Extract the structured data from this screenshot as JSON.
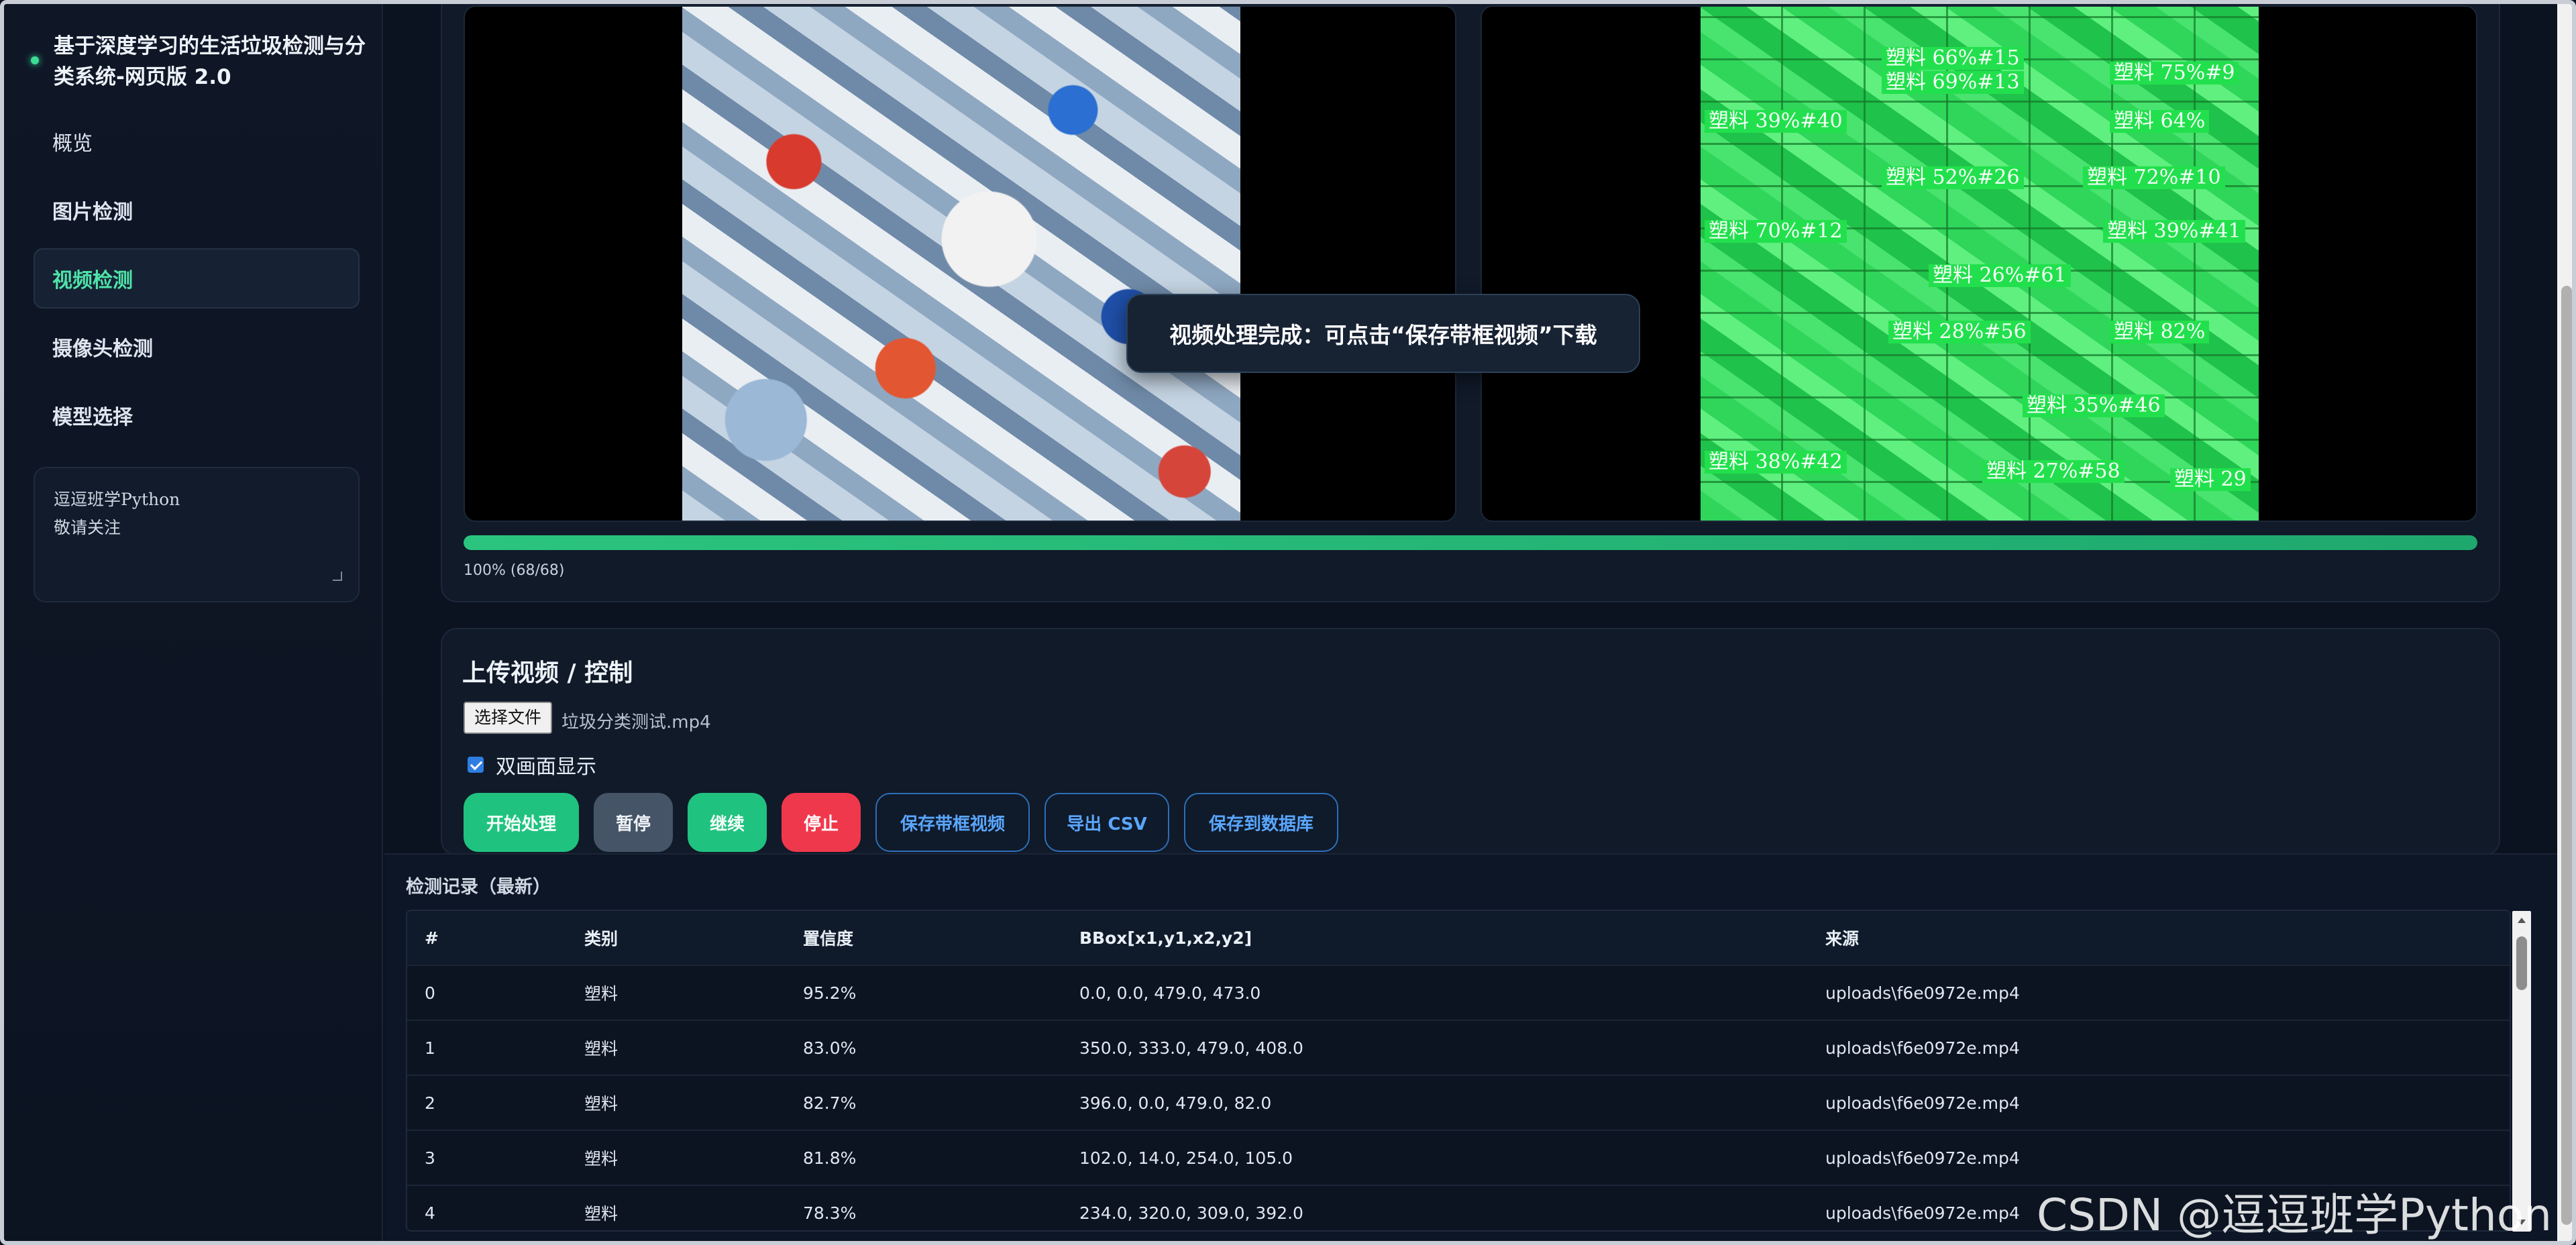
{
  "sidebar": {
    "title": "基于深度学习的生活垃圾检测与分类系统-网页版 2.0",
    "items": [
      {
        "label": "概览"
      },
      {
        "label": "图片检测"
      },
      {
        "label": "视频检测"
      },
      {
        "label": "摄像头检测"
      },
      {
        "label": "模型选择"
      }
    ],
    "note": "逗逗班学Python\n敬请关注"
  },
  "preview": {
    "tags": [
      "塑料 66%#15",
      "塑料 69%#13",
      "塑料 75%#9",
      "塑料 39%#40",
      "塑料 64%",
      "塑料 52%#26",
      "塑料 72%#10",
      "塑料 70%#12",
      "塑料 39%#41",
      "塑料 26%#61",
      "塑料 28%#56",
      "塑料 82%",
      "塑料 35%#46",
      "塑料 38%#42",
      "塑料 27%#58",
      "塑料 29"
    ],
    "toast": "视频处理完成：可点击“保存带框视频”下载",
    "progress": 1.0,
    "progress_text": "100% (68/68)"
  },
  "control": {
    "title": "上传视频 / 控制",
    "file_button": "选择文件",
    "file_name": "垃圾分类测试.mp4",
    "dual_view_label": "双画面显示",
    "dual_view_checked": true,
    "buttons": {
      "start": "开始处理",
      "pause": "暂停",
      "resume": "继续",
      "stop": "停止",
      "save_video": "保存带框视频",
      "export_csv": "导出 CSV",
      "save_db": "保存到数据库"
    },
    "colors": {
      "green": "#20c27f",
      "gray": "#465468",
      "red": "#f0384c",
      "outline": "#5aa6ff"
    }
  },
  "records": {
    "title": "检测记录（最新）",
    "columns": [
      "#",
      "类别",
      "置信度",
      "BBox[x1,y1,x2,y2]",
      "来源"
    ],
    "rows": [
      [
        "0",
        "塑料",
        "95.2%",
        "0.0, 0.0, 479.0, 473.0",
        "uploads\\f6e0972e.mp4"
      ],
      [
        "1",
        "塑料",
        "83.0%",
        "350.0, 333.0, 479.0, 408.0",
        "uploads\\f6e0972e.mp4"
      ],
      [
        "2",
        "塑料",
        "82.7%",
        "396.0, 0.0, 479.0, 82.0",
        "uploads\\f6e0972e.mp4"
      ],
      [
        "3",
        "塑料",
        "81.8%",
        "102.0, 14.0, 254.0, 105.0",
        "uploads\\f6e0972e.mp4"
      ],
      [
        "4",
        "塑料",
        "78.3%",
        "234.0, 320.0, 309.0, 392.0",
        "uploads\\f6e0972e.mp4"
      ]
    ]
  },
  "watermark": "CSDN @逗逗班学Python"
}
